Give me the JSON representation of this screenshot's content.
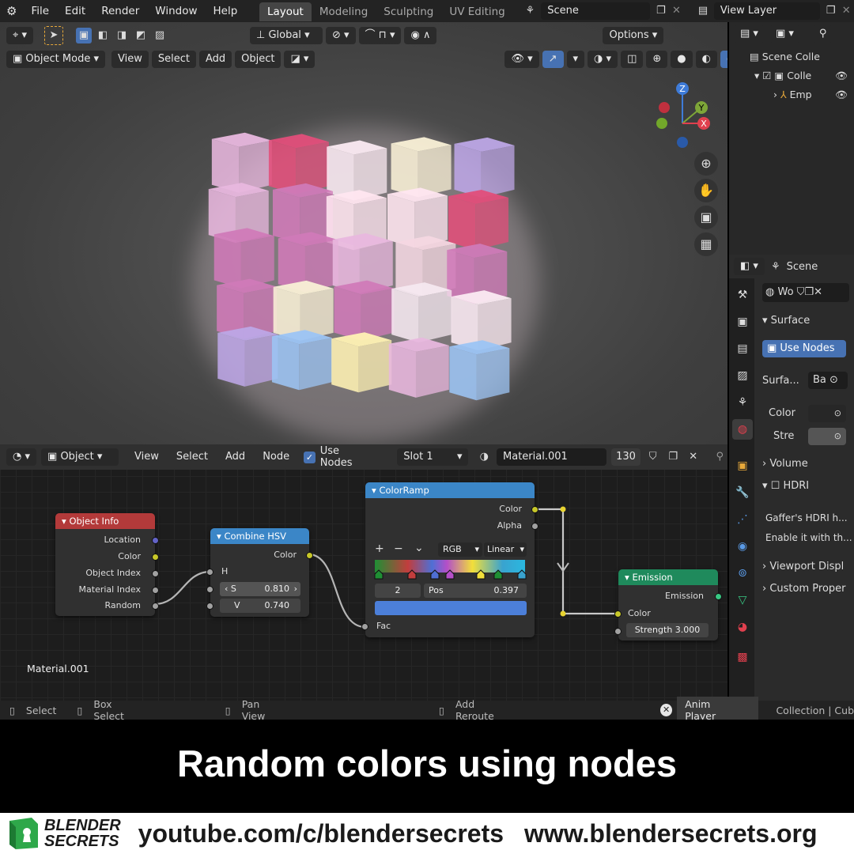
{
  "menu": {
    "items": [
      "File",
      "Edit",
      "Render",
      "Window",
      "Help"
    ]
  },
  "workspaces": {
    "tabs": [
      "Layout",
      "Modeling",
      "Sculpting",
      "UV Editing"
    ],
    "active": "Layout"
  },
  "scene": {
    "name": "Scene",
    "view_layer": "View Layer"
  },
  "viewport": {
    "toolbar": {
      "transform_orientation": "Global",
      "options_label": "Options"
    },
    "header": {
      "mode": "Object Mode",
      "view": "View",
      "select": "Select",
      "add": "Add",
      "object": "Object"
    },
    "gizmo": {
      "z": "Z",
      "y": "Y",
      "x": "X"
    }
  },
  "outliner": {
    "items": [
      "Scene Colle",
      "Colle",
      "Emp"
    ]
  },
  "properties": {
    "context": "Scene",
    "world_name": "Wo",
    "surface_panel": "Surface",
    "use_nodes": "Use Nodes",
    "surface_label": "Surfa...",
    "surface_value": "Ba",
    "color_label": "Color",
    "strength_label": "Stre",
    "volume_panel": "Volume",
    "hdri_panel": "HDRI",
    "hdri_text1": "Gaffer's HDRI h...",
    "hdri_text2": "Enable it with th...",
    "viewport_display": "Viewport Displ",
    "custom_props": "Custom Proper"
  },
  "node_editor": {
    "header": {
      "type": "Object",
      "view": "View",
      "select": "Select",
      "add": "Add",
      "node": "Node",
      "use_nodes": "Use Nodes",
      "slot": "Slot 1",
      "material": "Material.001",
      "users": "130"
    },
    "material_label": "Material.001",
    "object_info": {
      "title": "Object Info",
      "outputs": [
        "Location",
        "Color",
        "Object Index",
        "Material Index",
        "Random"
      ]
    },
    "combine_hsv": {
      "title": "Combine HSV",
      "output": "Color",
      "h": "H",
      "s_label": "S",
      "s_value": "0.810",
      "v_label": "V",
      "v_value": "0.740"
    },
    "color_ramp": {
      "title": "ColorRamp",
      "out_color": "Color",
      "out_alpha": "Alpha",
      "mode": "RGB",
      "interp": "Linear",
      "index": "2",
      "pos_label": "Pos",
      "pos_value": "0.397",
      "input": "Fac",
      "add": "+",
      "remove": "−",
      "more": "⌄"
    },
    "emission": {
      "title": "Emission",
      "output": "Emission",
      "color": "Color",
      "strength_label": "Strength",
      "strength_value": "3.000"
    }
  },
  "statusbar": {
    "select": "Select",
    "box_select": "Box Select",
    "pan_view": "Pan View",
    "add_reroute": "Add Reroute",
    "anim_player": "Anim Player",
    "collection": "Collection | Cub"
  },
  "caption": "Random colors using nodes",
  "brand": {
    "line1": "BLENDER",
    "line2": "SECRETS",
    "youtube": "youtube.com/c/blendersecrets",
    "website": "www.blendersecrets.org"
  },
  "colors": {
    "accent": "#4772b3",
    "object_info": "#b33a3a",
    "converter": "#3b86c7",
    "shader": "#1f8a5c"
  }
}
